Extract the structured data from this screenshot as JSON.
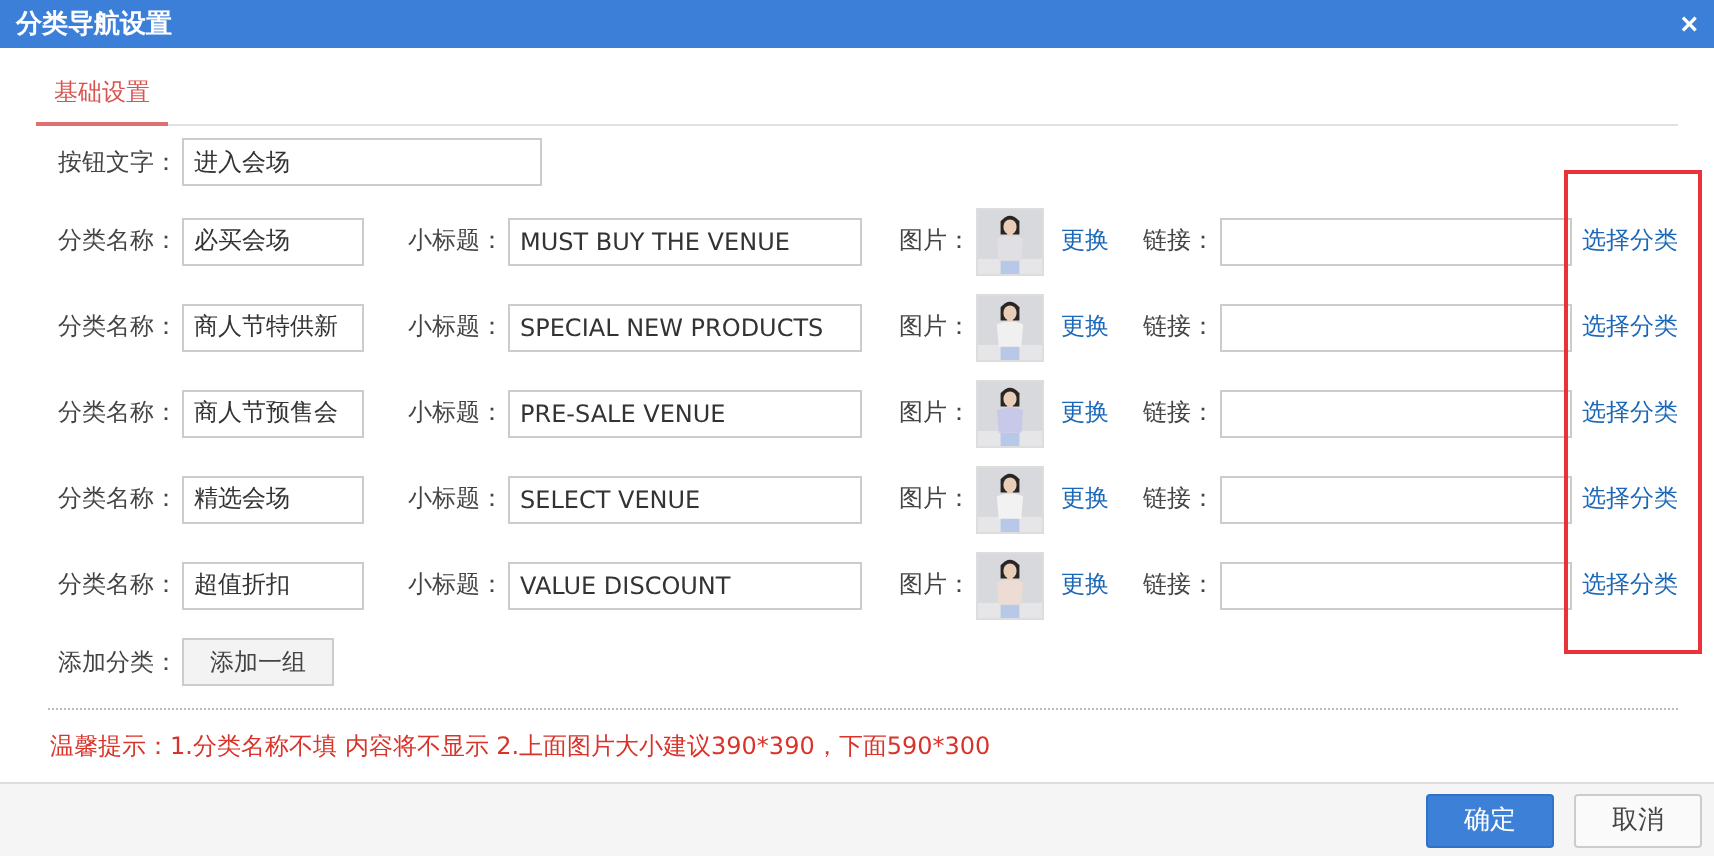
{
  "window": {
    "title": "分类导航设置",
    "close": "×"
  },
  "tabs": [
    {
      "label": "基础设置",
      "selected": true
    }
  ],
  "button_text": {
    "label": "按钮文字：",
    "value": "进入会场"
  },
  "categories": [
    {
      "name_label": "分类名称：",
      "name": "必买会场",
      "subtitle_label": "小标题：",
      "subtitle": "MUST BUY THE VENUE",
      "image_label": "图片：",
      "replace": "更换",
      "link_label": "链接：",
      "choose": "选择分类"
    },
    {
      "name_label": "分类名称：",
      "name": "商人节特供新",
      "subtitle_label": "小标题：",
      "subtitle": "SPECIAL NEW PRODUCTS",
      "image_label": "图片：",
      "replace": "更换",
      "link_label": "链接：",
      "choose": "选择分类"
    },
    {
      "name_label": "分类名称：",
      "name": "商人节预售会",
      "subtitle_label": "小标题：",
      "subtitle": "PRE-SALE VENUE",
      "image_label": "图片：",
      "replace": "更换",
      "link_label": "链接：",
      "choose": "选择分类"
    },
    {
      "name_label": "分类名称：",
      "name": "精选会场",
      "subtitle_label": "小标题：",
      "subtitle": "SELECT VENUE",
      "image_label": "图片：",
      "replace": "更换",
      "link_label": "链接：",
      "choose": "选择分类"
    },
    {
      "name_label": "分类名称：",
      "name": "超值折扣",
      "subtitle_label": "小标题：",
      "subtitle": "VALUE DISCOUNT",
      "image_label": "图片：",
      "replace": "更换",
      "link_label": "链接：",
      "choose": "选择分类"
    }
  ],
  "add_category": {
    "label": "添加分类：",
    "button": "添加一组"
  },
  "tip": "温馨提示：1.分类名称不填 内容将不显示 2.上面图片大小建议390*390，下面590*300",
  "buttons": [
    {
      "label": "确定",
      "kind": "primary"
    },
    {
      "label": "取消",
      "kind": "secondary"
    }
  ]
}
